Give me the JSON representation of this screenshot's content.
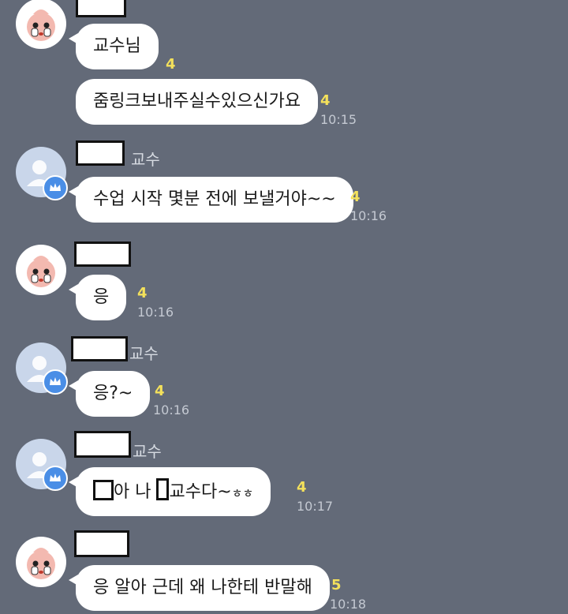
{
  "colors": {
    "background": "#636a78",
    "bubble": "#ffffff",
    "unread": "#f4e15b",
    "time": "#c4c9d2",
    "crown_badge": "#4a8ee6"
  },
  "messages": [
    {
      "sender": "me",
      "text": "교수님",
      "unread": "4",
      "time": ""
    },
    {
      "sender": "me",
      "text": "줌링크보내주실수있으신가요",
      "unread": "4",
      "time": "10:15"
    },
    {
      "sender": "professor",
      "sender_suffix": "교수",
      "text": "수업 시작 몇분 전에 보낼거야~~",
      "unread": "4",
      "time": "10:16"
    },
    {
      "sender": "me",
      "text": "응",
      "unread": "4",
      "time": "10:16"
    },
    {
      "sender": "professor",
      "sender_suffix": "교수",
      "text": "응?~",
      "unread": "4",
      "time": "10:16"
    },
    {
      "sender": "professor",
      "sender_suffix": "교수",
      "text_a": "아 나",
      "text_b": "교수다~",
      "text_c": "ㅎㅎ",
      "unread": "4",
      "time": "10:17"
    },
    {
      "sender": "me",
      "text": "응 알아 근데 왜 나한테 반말해",
      "unread": "5",
      "time": "10:18"
    }
  ]
}
